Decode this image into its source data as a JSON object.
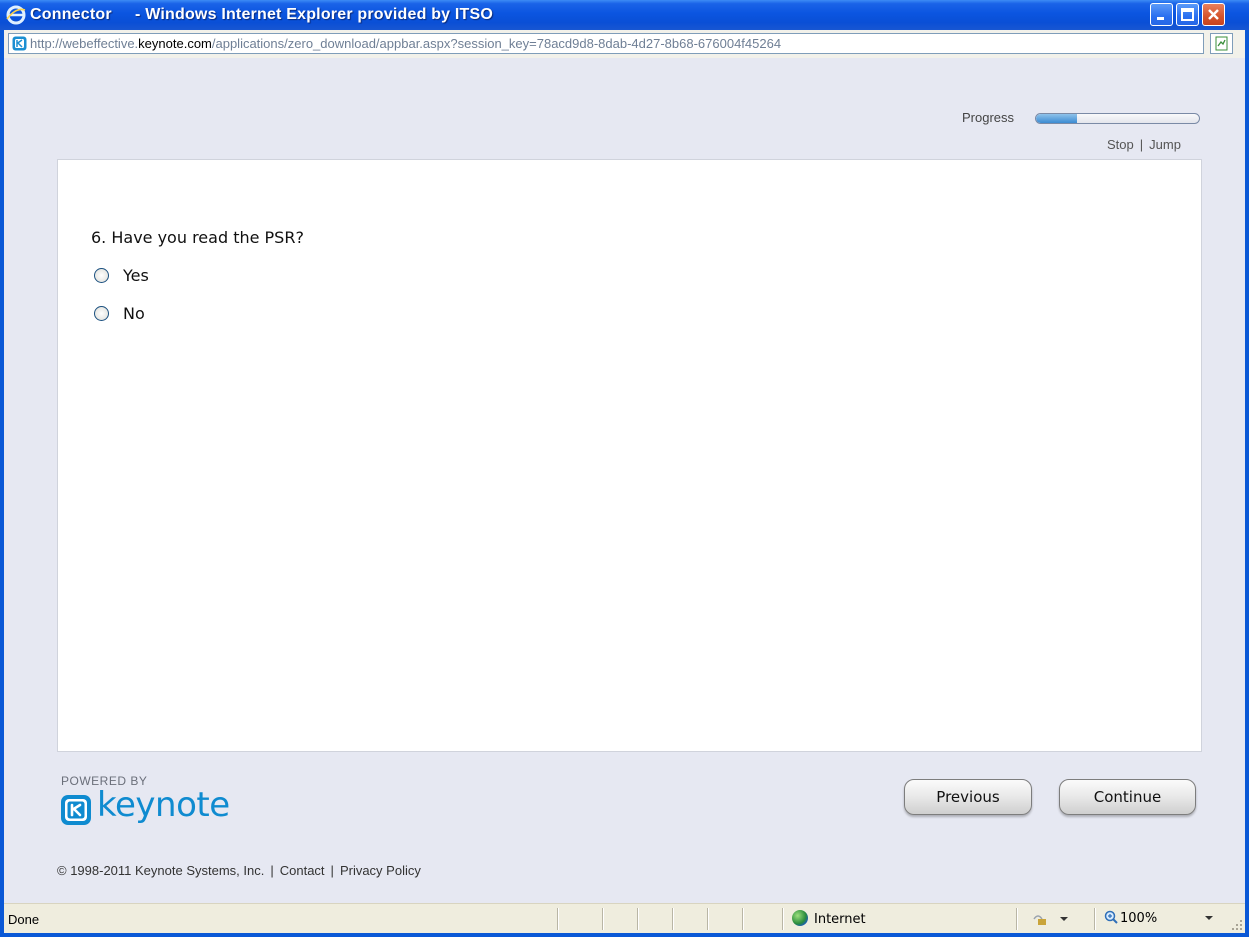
{
  "window": {
    "title": "Connector     - Windows Internet Explorer provided by ITSO"
  },
  "address": {
    "url_prefix": "http://webeffective.",
    "url_host": "keynote.com",
    "url_path": "/applications/zero_download/appbar.aspx?session_key=78acd9d8-8dab-4d27-8b68-676004f45264"
  },
  "header": {
    "progress_label": "Progress",
    "progress_fraction": 0.25,
    "stop_label": "Stop",
    "link_separator": "|",
    "jump_label": "Jump"
  },
  "survey": {
    "question": "6. Have you read the PSR?",
    "options": [
      "Yes",
      "No"
    ]
  },
  "branding": {
    "powered_by": "POWERED BY",
    "logo_text": "keynote"
  },
  "nav": {
    "previous_label": "Previous",
    "continue_label": "Continue"
  },
  "footer": {
    "copyright": "© 1998-2011 Keynote Systems, Inc.",
    "separator": "|",
    "contact": "Contact",
    "privacy": "Privacy Policy"
  },
  "status": {
    "text": "Done",
    "zone": "Internet",
    "zoom": "100%"
  },
  "colors": {
    "titlebar": "#0a55e0",
    "accent": "#0f8bd0",
    "close_button": "#d4532c"
  }
}
